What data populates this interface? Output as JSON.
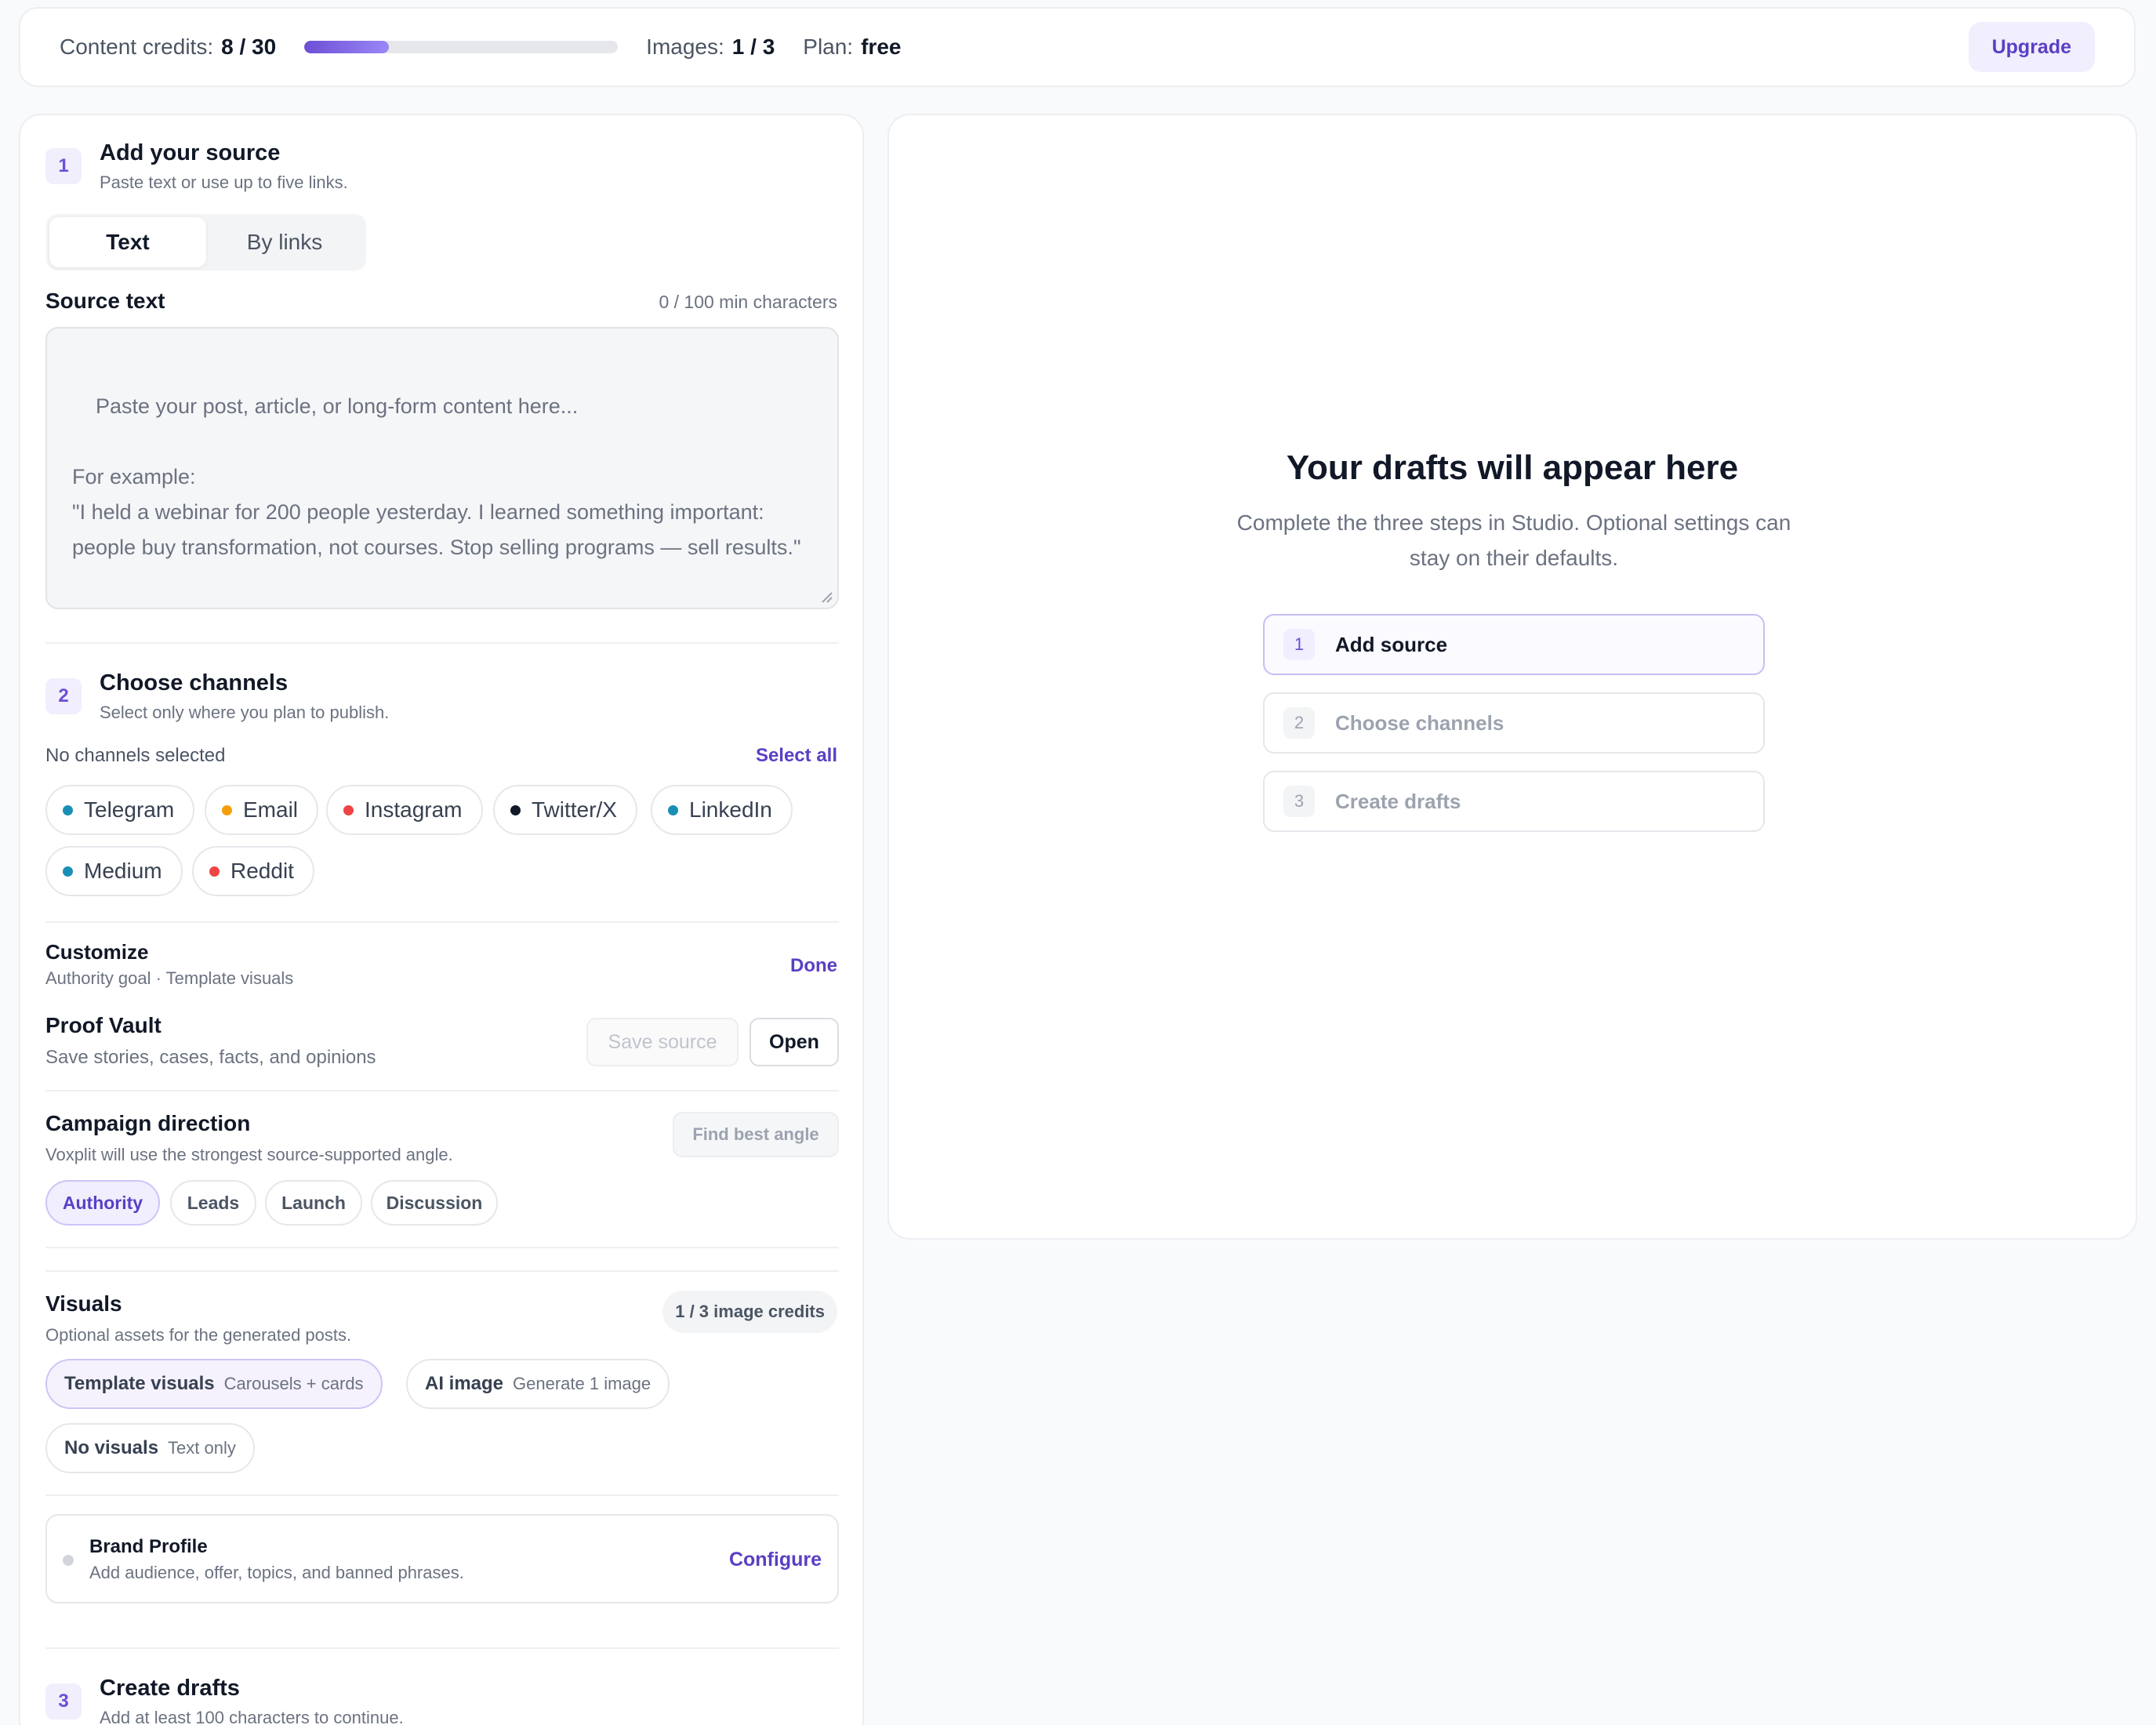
{
  "topbar": {
    "credits_label": "Content credits:",
    "credits_value": "8 / 30",
    "credits_progress": 0.27,
    "images_label": "Images:",
    "images_value": "1 / 3",
    "plan_label": "Plan:",
    "plan_value": "free",
    "upgrade_label": "Upgrade"
  },
  "step1": {
    "num": "1",
    "title": "Add your source",
    "subtitle": "Paste text or use up to five links.",
    "tabs": [
      "Text",
      "By links"
    ],
    "source_label": "Source text",
    "char_count": "0 / 100 min characters",
    "placeholder": "Paste your post, article, or long-form content here...\n\nFor example:\n\"I held a webinar for 200 people yesterday. I learned something important: people buy transformation, not courses. Stop selling programs — sell results.\""
  },
  "step2": {
    "num": "2",
    "title": "Choose channels",
    "subtitle": "Select only where you plan to publish.",
    "status": "No channels selected",
    "select_all": "Select all",
    "channels": [
      {
        "label": "Telegram",
        "color": "#1a8fb5"
      },
      {
        "label": "Email",
        "color": "#f59e0b"
      },
      {
        "label": "Instagram",
        "color": "#ef4444"
      },
      {
        "label": "Twitter/X",
        "color": "#111827"
      },
      {
        "label": "LinkedIn",
        "color": "#1a8fb5"
      },
      {
        "label": "Medium",
        "color": "#1a8fb5"
      },
      {
        "label": "Reddit",
        "color": "#ef4444"
      }
    ]
  },
  "customize": {
    "title": "Customize",
    "subtitle": "Authority goal · Template visuals",
    "done": "Done"
  },
  "vault": {
    "title": "Proof Vault",
    "subtitle": "Save stories, cases, facts, and opinions",
    "save_label": "Save source",
    "open_label": "Open"
  },
  "campaign": {
    "title": "Campaign direction",
    "subtitle": "Voxplit will use the strongest source-supported angle.",
    "find_label": "Find best angle",
    "options": [
      "Authority",
      "Leads",
      "Launch",
      "Discussion"
    ]
  },
  "visuals": {
    "title": "Visuals",
    "subtitle": "Optional assets for the generated posts.",
    "credits_badge": "1 / 3 image credits",
    "options": [
      {
        "label": "Template visuals",
        "sub": "Carousels + cards"
      },
      {
        "label": "AI image",
        "sub": "Generate 1 image"
      },
      {
        "label": "No visuals",
        "sub": "Text only"
      }
    ]
  },
  "brand": {
    "title": "Brand Profile",
    "subtitle": "Add audience, offer, topics, and banned phrases.",
    "configure": "Configure"
  },
  "step3": {
    "num": "3",
    "title": "Create drafts",
    "subtitle": "Add at least 100 characters to continue."
  },
  "empty_state": {
    "title": "Your drafts will appear here",
    "subtitle": "Complete the three steps in Studio. Optional settings can stay on their defaults.",
    "steps": [
      {
        "num": "1",
        "label": "Add source"
      },
      {
        "num": "2",
        "label": "Choose channels"
      },
      {
        "num": "3",
        "label": "Create drafts"
      }
    ]
  }
}
